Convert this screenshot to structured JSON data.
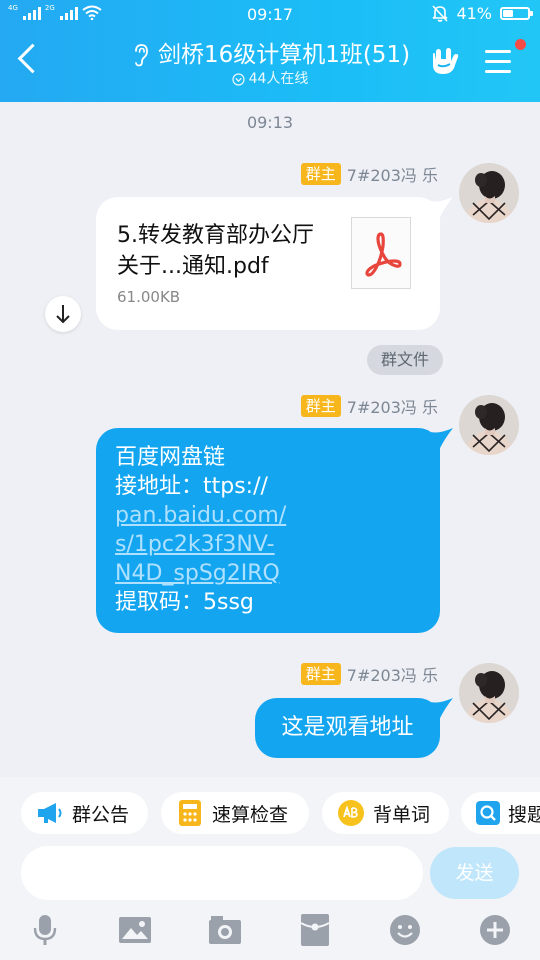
{
  "status": {
    "time": "09:17",
    "battery": "41%",
    "battery_level": 0.41,
    "net1": "4G",
    "net2": "2G"
  },
  "header": {
    "title": "剑桥16级计算机1班(51)",
    "online": "44人在线"
  },
  "chat": {
    "time_separator": "09:13",
    "messages": [
      {
        "badge": "群主",
        "sender": "7#203冯 乐",
        "file_name": "5.转发教育部办公厅关于...通知.pdf",
        "file_size": "61.00KB",
        "tag": "群文件"
      },
      {
        "badge": "群主",
        "sender": "7#203冯 乐",
        "text_lines": [
          "百度网盘链",
          "接地址：ttps://"
        ],
        "link_lines": [
          "pan.baidu.com/",
          "s/1pc2k3f3NV-",
          "N4D_spSg2IRQ"
        ],
        "text_tail": "提取码：5ssg"
      },
      {
        "badge": "群主",
        "sender": "7#203冯 乐",
        "text": "这是观看地址"
      }
    ]
  },
  "quick_actions": [
    {
      "label": "群公告",
      "icon": "megaphone-icon"
    },
    {
      "label": "速算检查",
      "icon": "calculator-icon"
    },
    {
      "label": "背单词",
      "icon": "abc-icon"
    },
    {
      "label": "搜题",
      "icon": "search-icon"
    }
  ],
  "composer": {
    "send_label": "发送",
    "value": ""
  },
  "toolbar": [
    "microphone-icon",
    "image-icon",
    "camera-icon",
    "red-packet-icon",
    "emoji-icon",
    "plus-icon"
  ],
  "colors": {
    "header": "#1bbdf7",
    "bubble": "#13a5f0",
    "badge": "#f7b61c",
    "pdf_red": "#e8453c"
  }
}
